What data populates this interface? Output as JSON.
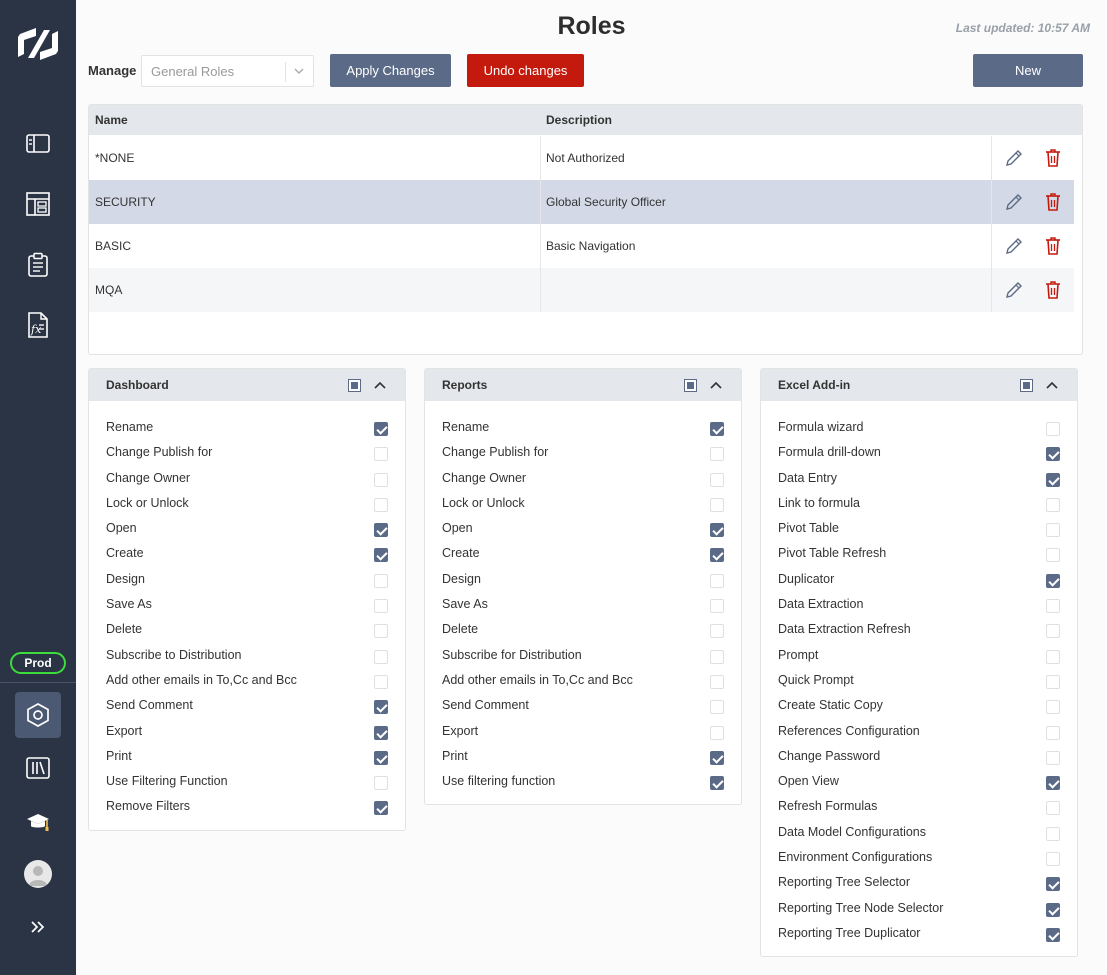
{
  "header": {
    "title": "Roles",
    "last_updated": "Last updated: 10:57 AM"
  },
  "sidebar": {
    "env_badge": "Prod",
    "icons": [
      "logo-icon",
      "panel-icon",
      "dashboard-icon",
      "clipboard-icon",
      "formula-doc-icon",
      "settings-hexagon-icon",
      "library-icon",
      "graduation-cap-icon",
      "user-avatar-icon",
      "expand-icon"
    ]
  },
  "toolbar": {
    "manage_label": "Manage",
    "manage_value": "General Roles",
    "apply_label": "Apply Changes",
    "undo_label": "Undo changes",
    "new_label": "New"
  },
  "roles_table": {
    "headers": {
      "name": "Name",
      "description": "Description"
    },
    "rows": [
      {
        "name": "*NONE",
        "description": "Not Authorized",
        "selected": false
      },
      {
        "name": "SECURITY",
        "description": "Global Security Officer",
        "selected": true
      },
      {
        "name": "BASIC",
        "description": "Basic Navigation",
        "selected": false
      },
      {
        "name": "MQA",
        "description": "",
        "selected": false
      }
    ]
  },
  "panels": [
    {
      "title": "Dashboard",
      "items": [
        {
          "label": "Rename",
          "checked": true
        },
        {
          "label": "Change Publish for",
          "checked": false
        },
        {
          "label": "Change Owner",
          "checked": false
        },
        {
          "label": "Lock or Unlock",
          "checked": false
        },
        {
          "label": "Open",
          "checked": true
        },
        {
          "label": "Create",
          "checked": true
        },
        {
          "label": "Design",
          "checked": false
        },
        {
          "label": "Save As",
          "checked": false
        },
        {
          "label": "Delete",
          "checked": false
        },
        {
          "label": "Subscribe to Distribution",
          "checked": false
        },
        {
          "label": "Add other emails in To,Cc and Bcc",
          "checked": false
        },
        {
          "label": "Send Comment",
          "checked": true
        },
        {
          "label": "Export",
          "checked": true
        },
        {
          "label": "Print",
          "checked": true
        },
        {
          "label": "Use Filtering Function",
          "checked": false
        },
        {
          "label": "Remove Filters",
          "checked": true
        }
      ]
    },
    {
      "title": "Reports",
      "items": [
        {
          "label": "Rename",
          "checked": true
        },
        {
          "label": "Change Publish for",
          "checked": false
        },
        {
          "label": "Change Owner",
          "checked": false
        },
        {
          "label": "Lock or Unlock",
          "checked": false
        },
        {
          "label": "Open",
          "checked": true
        },
        {
          "label": "Create",
          "checked": true
        },
        {
          "label": "Design",
          "checked": false
        },
        {
          "label": "Save As",
          "checked": false
        },
        {
          "label": "Delete",
          "checked": false
        },
        {
          "label": "Subscribe for Distribution",
          "checked": false
        },
        {
          "label": "Add other emails in To,Cc and Bcc",
          "checked": false
        },
        {
          "label": "Send Comment",
          "checked": false
        },
        {
          "label": "Export",
          "checked": false
        },
        {
          "label": "Print",
          "checked": true
        },
        {
          "label": "Use filtering function",
          "checked": true
        }
      ]
    },
    {
      "title": "Excel Add-in",
      "items": [
        {
          "label": "Formula wizard",
          "checked": false
        },
        {
          "label": "Formula drill-down",
          "checked": true
        },
        {
          "label": "Data Entry",
          "checked": true
        },
        {
          "label": "Link to formula",
          "checked": false
        },
        {
          "label": "Pivot Table",
          "checked": false
        },
        {
          "label": "Pivot Table Refresh",
          "checked": false
        },
        {
          "label": "Duplicator",
          "checked": true
        },
        {
          "label": "Data Extraction",
          "checked": false
        },
        {
          "label": "Data Extraction Refresh",
          "checked": false
        },
        {
          "label": "Prompt",
          "checked": false
        },
        {
          "label": "Quick Prompt",
          "checked": false
        },
        {
          "label": "Create Static Copy",
          "checked": false
        },
        {
          "label": "References Configuration",
          "checked": false
        },
        {
          "label": "Change Password",
          "checked": false
        },
        {
          "label": "Open View",
          "checked": true
        },
        {
          "label": "Refresh Formulas",
          "checked": false
        },
        {
          "label": "Data Model Configurations",
          "checked": false
        },
        {
          "label": "Environment Configurations",
          "checked": false
        },
        {
          "label": "Reporting Tree Selector",
          "checked": true
        },
        {
          "label": "Reporting Tree Node Selector",
          "checked": true
        },
        {
          "label": "Reporting Tree Duplicator",
          "checked": true
        }
      ]
    }
  ],
  "colors": {
    "sidebar": "#2b3444",
    "accent": "#5b6b87",
    "danger": "#c41a0d",
    "env_green": "#3ddc3d",
    "selected_row": "#d3d9e6",
    "alt_row": "#f5f6f8"
  }
}
